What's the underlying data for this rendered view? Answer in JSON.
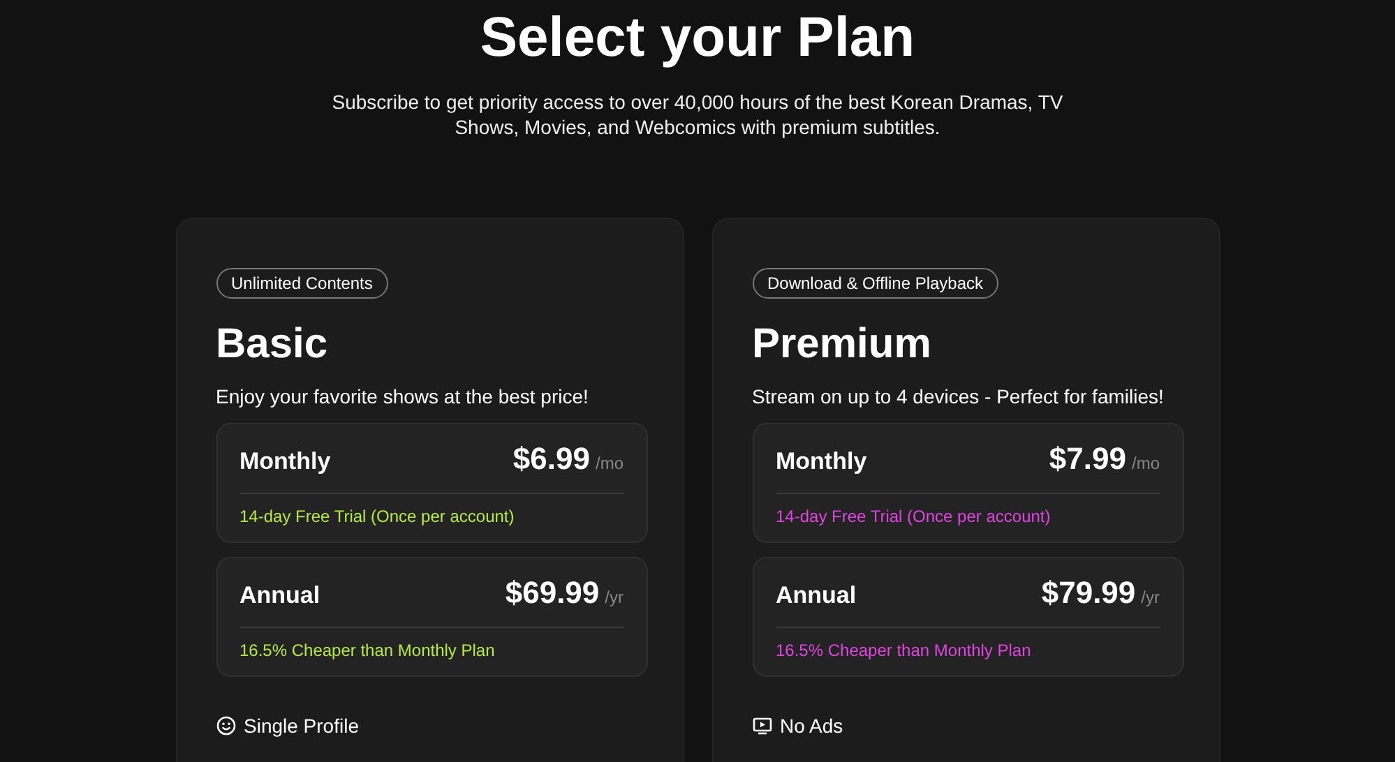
{
  "header": {
    "title": "Select your Plan",
    "subtitle": "Subscribe to get priority access to over 40,000 hours of the best Korean Dramas, TV Shows, Movies, and Webcomics with premium subtitles."
  },
  "plans": [
    {
      "tag": "Unlimited Contents",
      "name": "Basic",
      "description": "Enjoy your favorite shows at the best price!",
      "color": "#b6e84a",
      "options": [
        {
          "period": "Monthly",
          "price": "$6.99",
          "unit": "/mo",
          "note": "14-day Free Trial (Once per account)"
        },
        {
          "period": "Annual",
          "price": "$69.99",
          "unit": "/yr",
          "note": "16.5% Cheaper than Monthly Plan"
        }
      ],
      "features": [
        {
          "kind": "smiley",
          "label": "Single Profile"
        }
      ]
    },
    {
      "tag": "Download & Offline Playback",
      "name": "Premium",
      "description": "Stream on up to 4 devices - Perfect for families!",
      "color": "#e044e0",
      "options": [
        {
          "period": "Monthly",
          "price": "$7.99",
          "unit": "/mo",
          "note": "14-day Free Trial (Once per account)"
        },
        {
          "period": "Annual",
          "price": "$79.99",
          "unit": "/yr",
          "note": "16.5% Cheaper than Monthly Plan"
        }
      ],
      "features": [
        {
          "kind": "tv",
          "label": "No Ads"
        }
      ]
    }
  ]
}
